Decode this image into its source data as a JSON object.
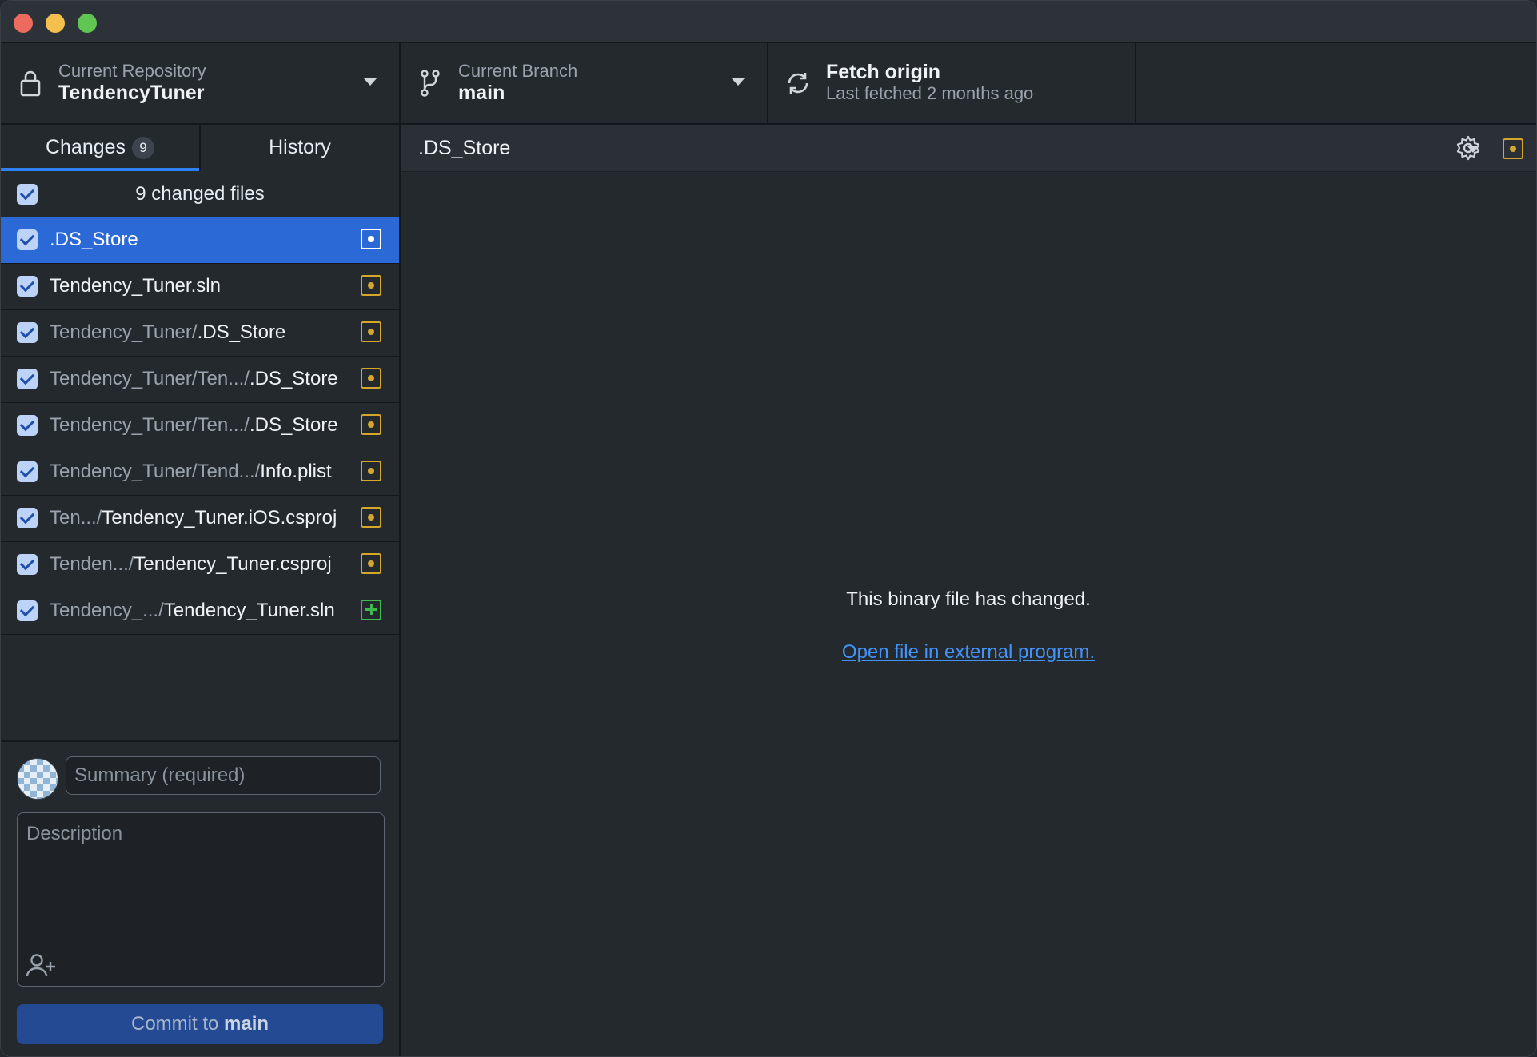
{
  "toolbar": {
    "repo": {
      "label": "Current Repository",
      "value": "TendencyTuner"
    },
    "branch": {
      "label": "Current Branch",
      "value": "main"
    },
    "fetch": {
      "label": "Fetch origin",
      "value": "Last fetched 2 months ago"
    }
  },
  "tabs": {
    "changes": "Changes",
    "changes_count": "9",
    "history": "History"
  },
  "files_header": "9 changed files",
  "files": [
    {
      "dir": "",
      "base": ".DS_Store",
      "status": "modified"
    },
    {
      "dir": "",
      "base": "Tendency_Tuner.sln",
      "status": "modified"
    },
    {
      "dir": "Tendency_Tuner/",
      "base": ".DS_Store",
      "status": "modified"
    },
    {
      "dir": "Tendency_Tuner/Ten.../",
      "base": ".DS_Store",
      "status": "modified"
    },
    {
      "dir": "Tendency_Tuner/Ten.../",
      "base": ".DS_Store",
      "status": "modified"
    },
    {
      "dir": "Tendency_Tuner/Tend.../",
      "base": "Info.plist",
      "status": "modified"
    },
    {
      "dir": "Ten.../",
      "base": "Tendency_Tuner.iOS.csproj",
      "status": "modified"
    },
    {
      "dir": "Tenden.../",
      "base": "Tendency_Tuner.csproj",
      "status": "modified"
    },
    {
      "dir": "Tendency_.../",
      "base": "Tendency_Tuner.sln",
      "status": "added"
    }
  ],
  "commit": {
    "summary_placeholder": "Summary (required)",
    "description_placeholder": "Description",
    "button_prefix": "Commit to ",
    "button_branch": "main"
  },
  "main": {
    "file_title": ".DS_Store",
    "binary_message": "This binary file has changed.",
    "open_link": "Open file in external program."
  },
  "icons": {
    "lock": "lock-icon",
    "branch": "branch-icon",
    "sync": "sync-icon",
    "gear": "gear-icon",
    "coauthor": "add-coauthor-icon"
  },
  "colors": {
    "accent": "#2f81f7",
    "selected_row": "#2b6ad6",
    "modified": "#d4a72c",
    "added": "#3fb950",
    "link": "#4493f8"
  }
}
